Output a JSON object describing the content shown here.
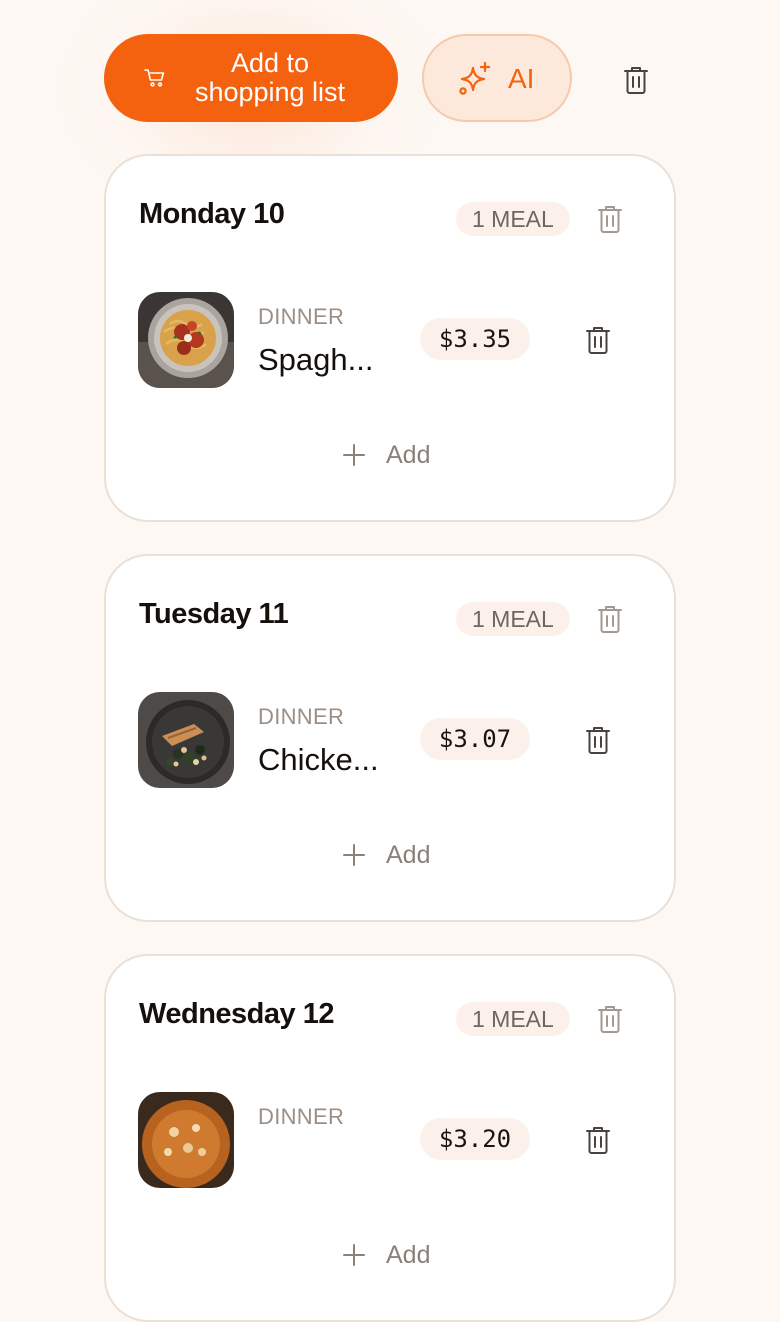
{
  "toolbar": {
    "shopping_label": "Add to shopping list",
    "shopping_icon": "cart-icon",
    "ai_label": "AI",
    "ai_icon": "sparkle-icon",
    "clear_icon": "trash-icon"
  },
  "colors": {
    "accent": "#f5620f",
    "ai_bg": "#fde9dc",
    "badge_bg": "#fcf1ea",
    "card_border": "#ebe0d6",
    "page_bg": "#fdf8f4"
  },
  "days": [
    {
      "title": "Monday 10",
      "count": "1 MEAL",
      "meal": {
        "type": "DINNER",
        "name": "Spagh...",
        "price": "$3.35",
        "image": "spaghetti-meatballs"
      },
      "add_label": "Add"
    },
    {
      "title": "Tuesday 11",
      "count": "1 MEAL",
      "meal": {
        "type": "DINNER",
        "name": "Chicke...",
        "price": "$3.07",
        "image": "chicken-dish"
      },
      "add_label": "Add"
    },
    {
      "title": "Wednesday 12",
      "count": "1 MEAL",
      "meal": {
        "type": "DINNER",
        "name": "",
        "price": "$3.20",
        "image": "orange-dish"
      },
      "add_label": "Add"
    }
  ]
}
